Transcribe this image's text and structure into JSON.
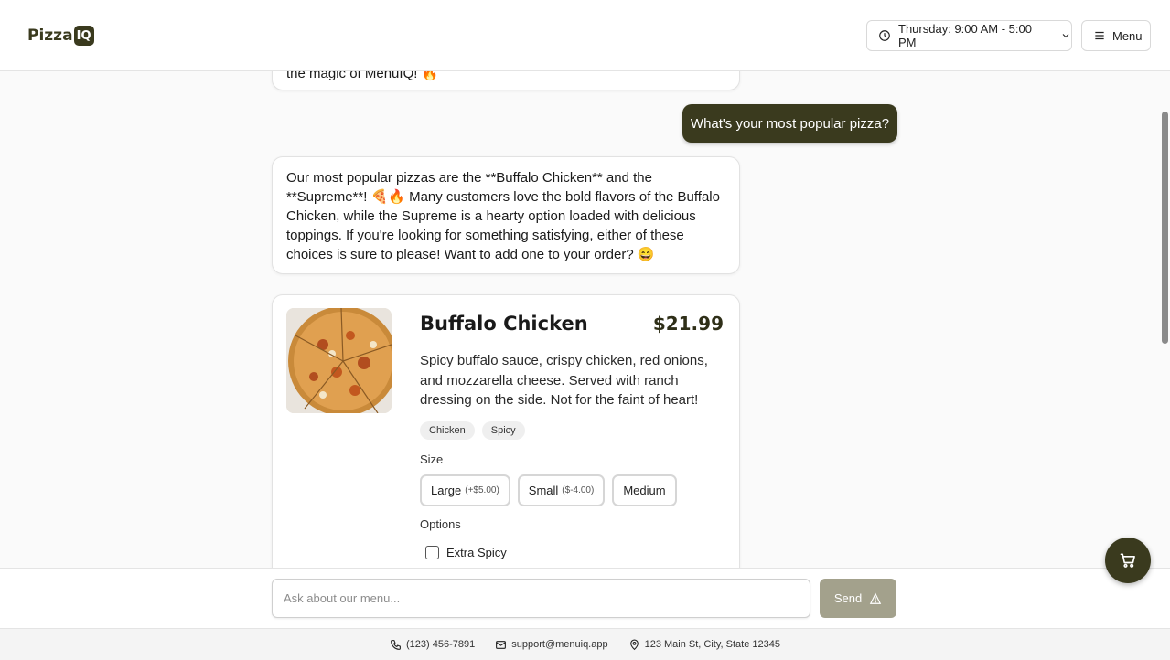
{
  "header": {
    "logo_text": "Pizza",
    "logo_badge": "IQ",
    "hours_label": "Thursday: 9:00 AM - 5:00 PM",
    "menu_label": "Menu"
  },
  "chat": {
    "previous_bot_tail": "the magic of MenuIQ! 🔥",
    "user_message": "What's your most popular pizza?",
    "bot_answer": "Our most popular pizzas are the **Buffalo Chicken** and the **Supreme**! 🍕🔥 Many customers love the bold flavors of the Buffalo Chicken, while the Supreme is a hearty option loaded with delicious toppings. If you're looking for something satisfying, either of these choices is sure to please! Want to add one to your order? 😄"
  },
  "product": {
    "name": "Buffalo Chicken",
    "price": "$21.99",
    "description": "Spicy buffalo sauce, crispy chicken, red onions, and mozzarella cheese. Served with ranch dressing on the side. Not for the faint of heart!",
    "tags": [
      "Chicken",
      "Spicy"
    ],
    "size_label": "Size",
    "sizes": [
      {
        "label": "Large",
        "modifier": "(+$5.00)"
      },
      {
        "label": "Small",
        "modifier": "($-4.00)"
      },
      {
        "label": "Medium",
        "modifier": ""
      }
    ],
    "options_label": "Options",
    "options": [
      {
        "label": "Extra Spicy",
        "checked": false
      }
    ]
  },
  "input": {
    "placeholder": "Ask about our menu...",
    "send_label": "Send"
  },
  "footer": {
    "phone": "(123) 456-7891",
    "email": "support@menuiq.app",
    "address": "123 Main St, City, State 12345"
  },
  "icons": {
    "clock": "clock-icon",
    "chevron": "chevron-down-icon",
    "menu": "hamburger-icon",
    "send": "send-icon",
    "cart": "cart-icon",
    "phone": "phone-icon",
    "mail": "mail-icon",
    "location": "location-pin-icon"
  },
  "colors": {
    "brand": "#3a3a1e",
    "send_button": "#a3a18c"
  }
}
